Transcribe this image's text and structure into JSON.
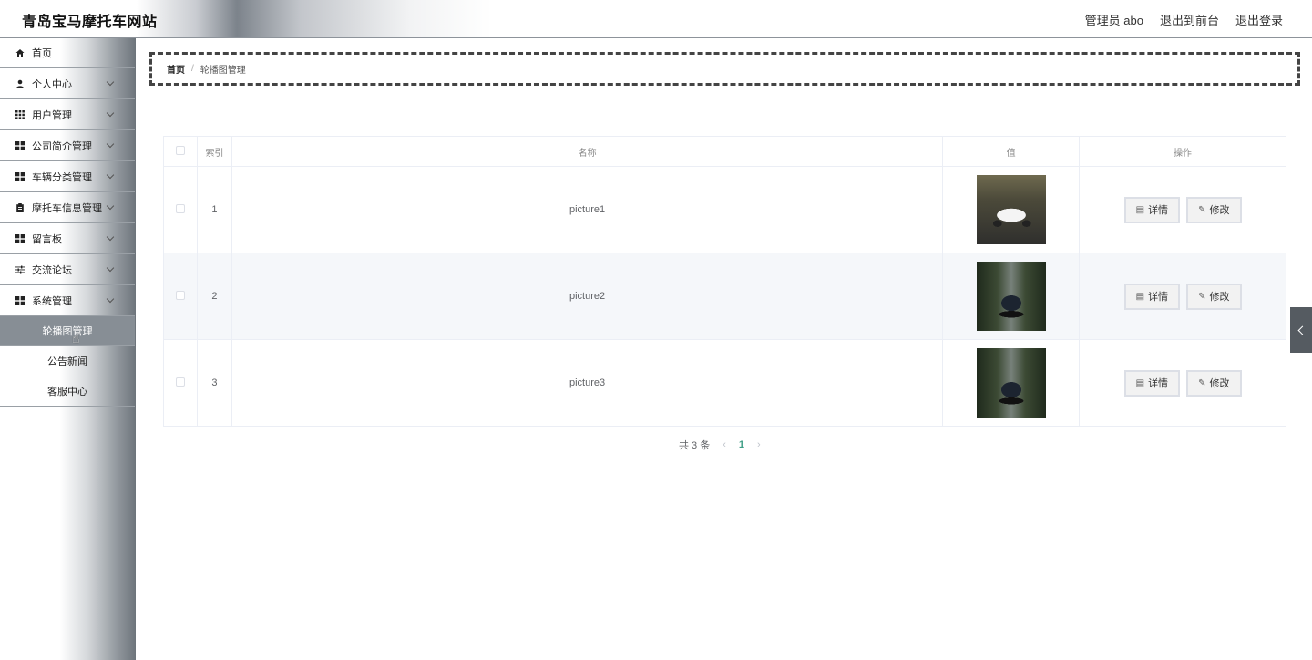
{
  "header": {
    "title": "青岛宝马摩托车网站",
    "admin": "管理员 abo",
    "to_front": "退出到前台",
    "logout": "退出登录"
  },
  "sidebar": {
    "items": [
      {
        "label": "首页",
        "icon": "home-icon"
      },
      {
        "label": "个人中心",
        "icon": "user-icon"
      },
      {
        "label": "用户管理",
        "icon": "grid-icon"
      },
      {
        "label": "公司简介管理",
        "icon": "grid-icon"
      },
      {
        "label": "车辆分类管理",
        "icon": "grid-icon"
      },
      {
        "label": "摩托车信息管理",
        "icon": "clipboard-icon"
      },
      {
        "label": "留言板",
        "icon": "grid-icon"
      },
      {
        "label": "交流论坛",
        "icon": "sliders-icon"
      },
      {
        "label": "系统管理",
        "icon": "grid-icon"
      }
    ],
    "sub_items": [
      "轮播图管理",
      "公告新闻",
      "客服中心"
    ]
  },
  "breadcrumb": {
    "home": "首页",
    "separator": "/",
    "current": "轮播图管理"
  },
  "table": {
    "headers": {
      "index": "索引",
      "name": "名称",
      "value": "值",
      "actions": "操作"
    },
    "rows": [
      {
        "index": "1",
        "name": "picture1"
      },
      {
        "index": "2",
        "name": "picture2"
      },
      {
        "index": "3",
        "name": "picture3"
      }
    ],
    "detail_label": "详情",
    "edit_label": "修改"
  },
  "pagination": {
    "total": "共 3 条",
    "current_page": "1"
  },
  "colors": {
    "accent": "#409f87",
    "sidebar_active": "#878e95"
  }
}
